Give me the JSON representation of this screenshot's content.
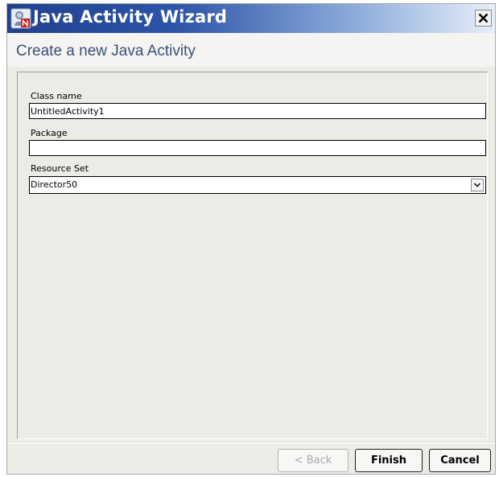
{
  "window": {
    "title": "Java Activity Wizard"
  },
  "header": {
    "subtitle": "Create a new Java Activity"
  },
  "form": {
    "class_name": {
      "label": "Class name",
      "value": "UntitledActivity1"
    },
    "package": {
      "label": "Package",
      "value": ""
    },
    "resource_set": {
      "label": "Resource Set",
      "selected": "Director50"
    }
  },
  "buttons": {
    "back_label": "< Back",
    "finish_label": "Finish",
    "cancel_label": "Cancel"
  },
  "icons": {
    "app": "app-icon",
    "close": "close-icon",
    "dropdown": "chevron-down-icon"
  }
}
